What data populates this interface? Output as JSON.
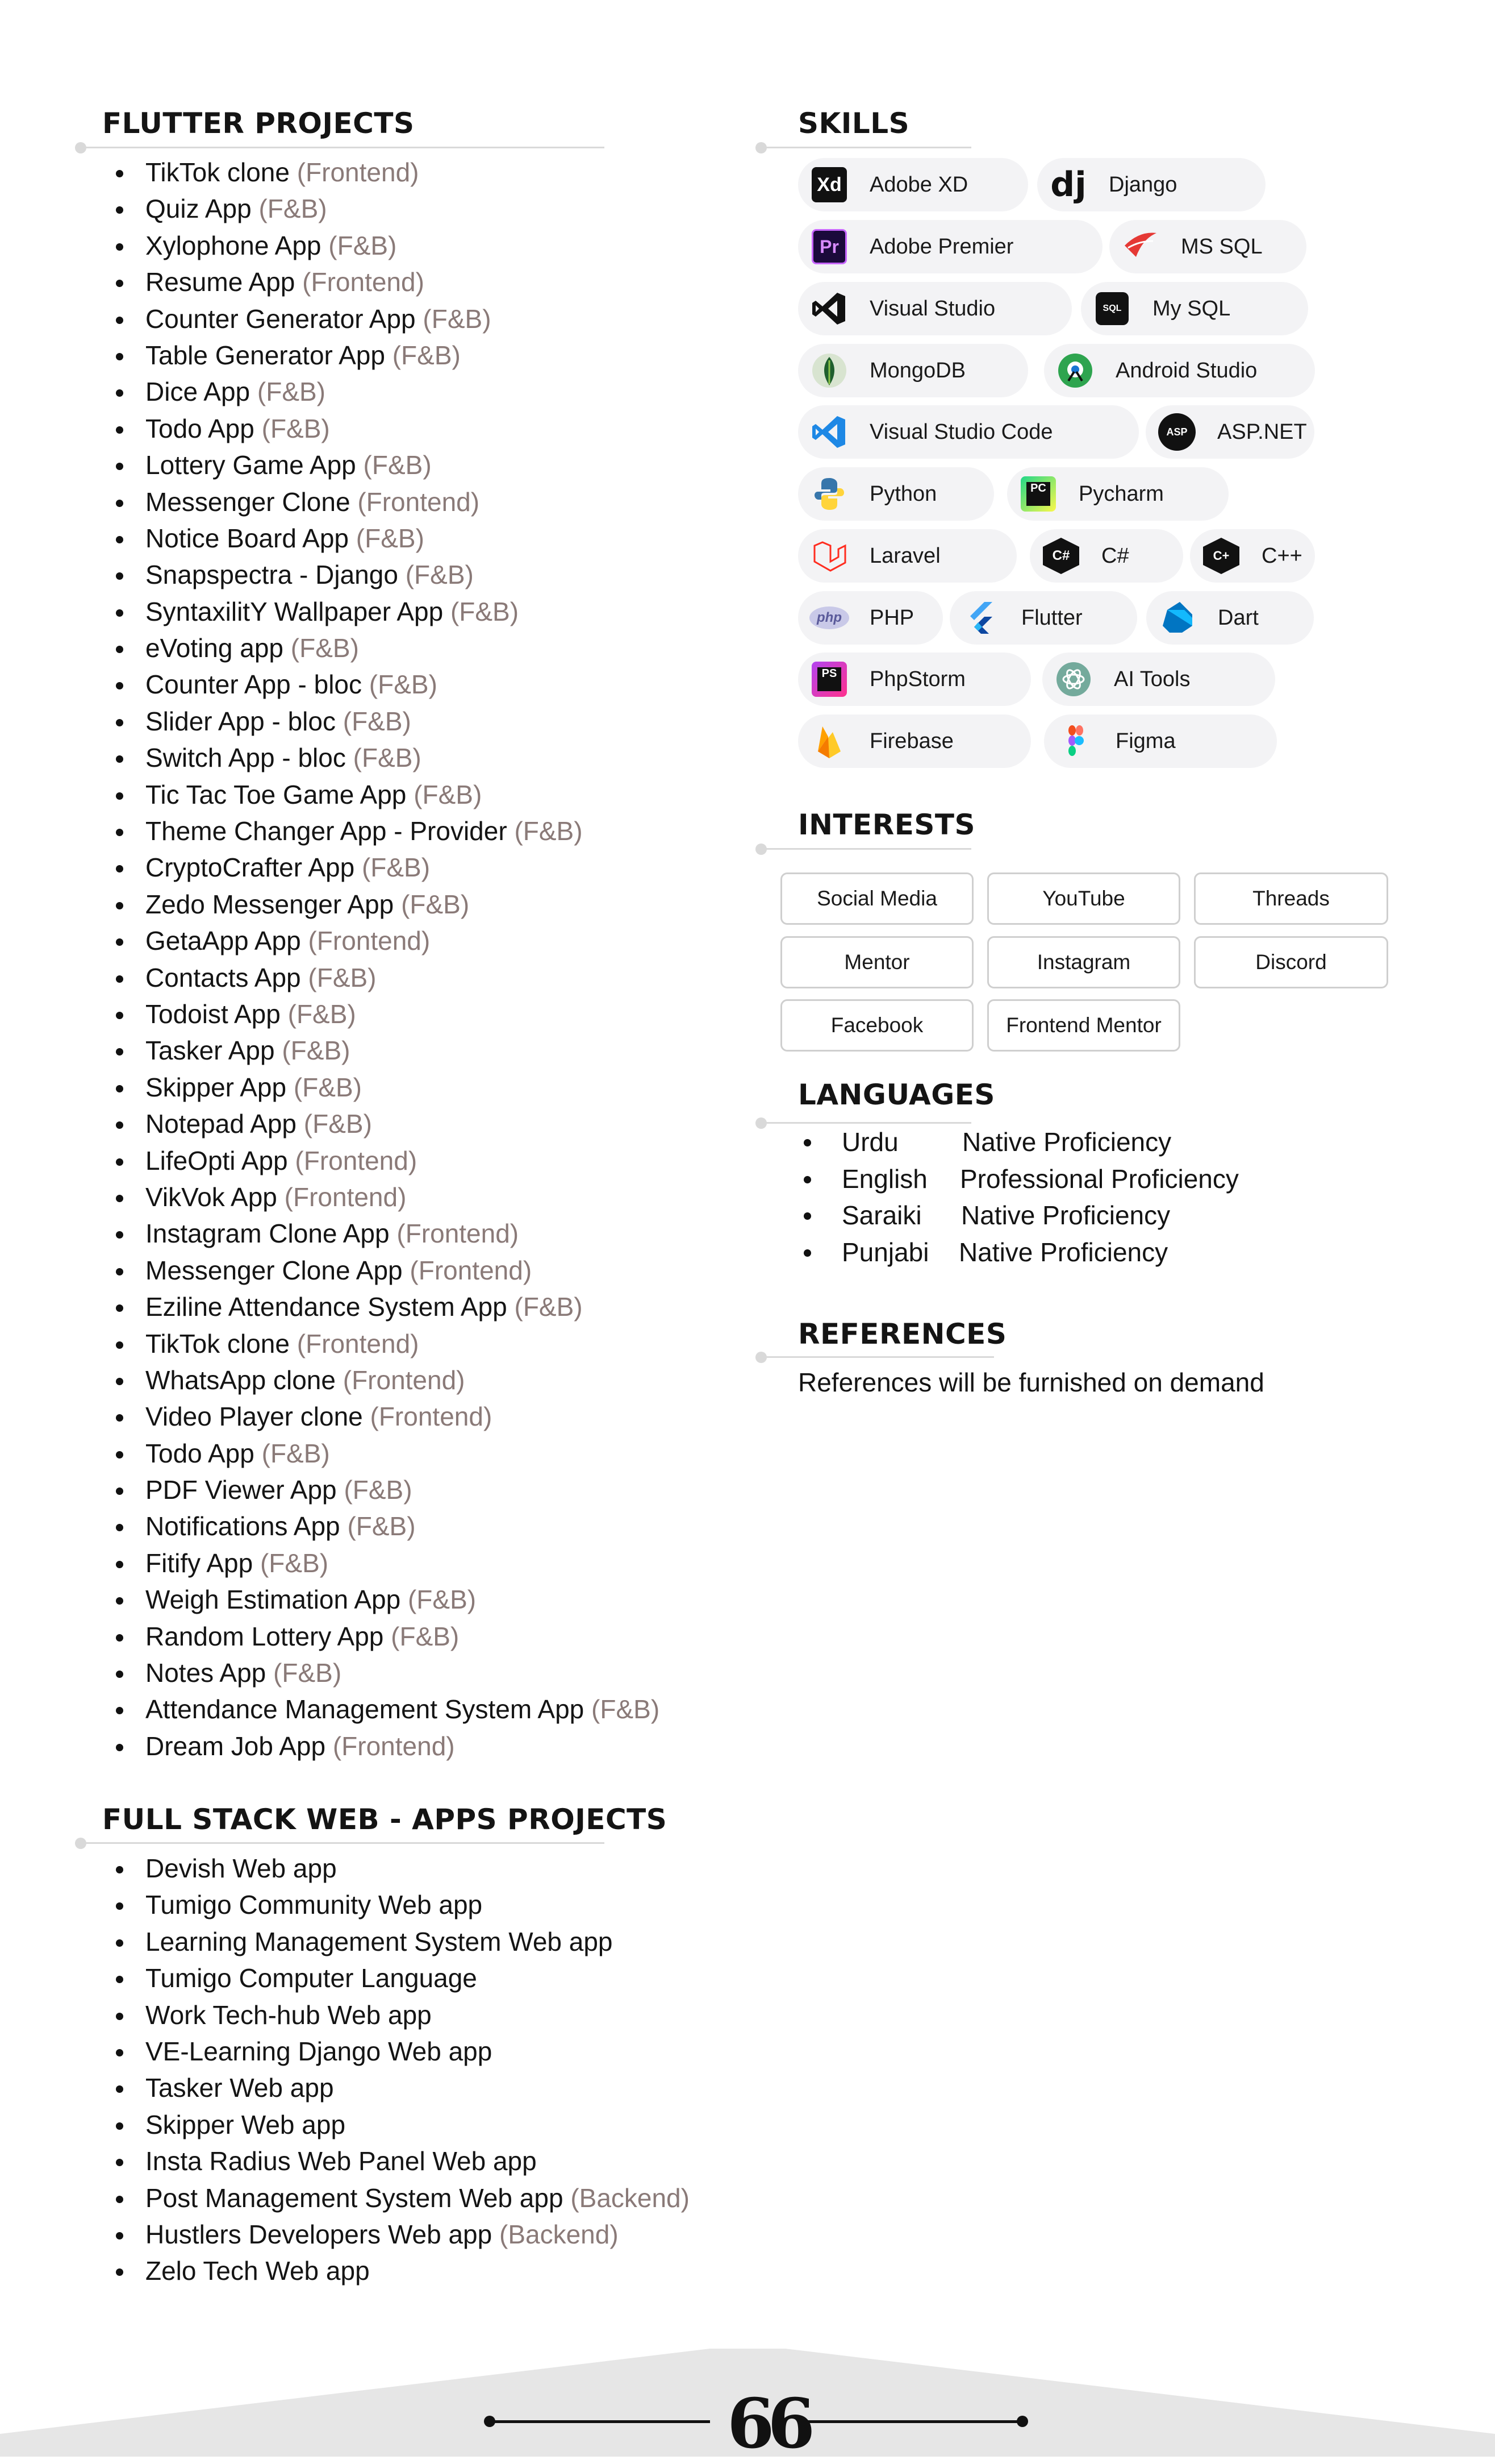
{
  "flutter": {
    "title": "FLUTTER PROJECTS",
    "items": [
      {
        "name": "TikTok clone",
        "tag": "(Frontend)"
      },
      {
        "name": "Quiz App",
        "tag": "(F&B)"
      },
      {
        "name": "Xylophone App",
        "tag": "(F&B)"
      },
      {
        "name": "Resume App",
        "tag": "(Frontend)"
      },
      {
        "name": "Counter Generator App",
        "tag": "(F&B)"
      },
      {
        "name": "Table Generator App",
        "tag": "(F&B)"
      },
      {
        "name": "Dice App",
        "tag": "(F&B)"
      },
      {
        "name": "Todo App",
        "tag": "(F&B)"
      },
      {
        "name": "Lottery Game App",
        "tag": "(F&B)"
      },
      {
        "name": "Messenger Clone",
        "tag": "(Frontend)"
      },
      {
        "name": "Notice Board App",
        "tag": "(F&B)"
      },
      {
        "name": "Snapspectra - Django",
        "tag": "(F&B)"
      },
      {
        "name": "SyntaxilitY Wallpaper App",
        "tag": "(F&B)"
      },
      {
        "name": "eVoting app",
        "tag": "(F&B)"
      },
      {
        "name": "Counter App - bloc",
        "tag": "(F&B)"
      },
      {
        "name": "Slider App - bloc",
        "tag": "(F&B)"
      },
      {
        "name": "Switch App - bloc",
        "tag": "(F&B)"
      },
      {
        "name": "Tic Tac Toe Game App",
        "tag": "(F&B)"
      },
      {
        "name": "Theme Changer App - Provider",
        "tag": "(F&B)"
      },
      {
        "name": "CryptoCrafter App",
        "tag": "(F&B)"
      },
      {
        "name": "Zedo Messenger App",
        "tag": "(F&B)"
      },
      {
        "name": "GetaApp App",
        "tag": "(Frontend)"
      },
      {
        "name": "Contacts App",
        "tag": "(F&B)"
      },
      {
        "name": "Todoist App",
        "tag": "(F&B)"
      },
      {
        "name": "Tasker App",
        "tag": "(F&B)"
      },
      {
        "name": "Skipper App",
        "tag": "(F&B)"
      },
      {
        "name": "Notepad App",
        "tag": "(F&B)"
      },
      {
        "name": "LifeOpti App",
        "tag": "(Frontend)"
      },
      {
        "name": "VikVok App",
        "tag": "(Frontend)"
      },
      {
        "name": "Instagram Clone App",
        "tag": "(Frontend)"
      },
      {
        "name": "Messenger Clone App",
        "tag": "(Frontend)"
      },
      {
        "name": "Eziline Attendance System App",
        "tag": "(F&B)"
      },
      {
        "name": "TikTok clone",
        "tag": "(Frontend)"
      },
      {
        "name": "WhatsApp clone",
        "tag": "(Frontend)"
      },
      {
        "name": "Video Player clone",
        "tag": "(Frontend)"
      },
      {
        "name": "Todo App",
        "tag": "(F&B)"
      },
      {
        "name": "PDF Viewer App",
        "tag": "(F&B)"
      },
      {
        "name": "Notifications App",
        "tag": "(F&B)"
      },
      {
        "name": "Fitify App",
        "tag": "(F&B)"
      },
      {
        "name": "Weigh Estimation App",
        "tag": "(F&B)"
      },
      {
        "name": "Random Lottery App",
        "tag": "(F&B)"
      },
      {
        "name": "Notes App",
        "tag": "(F&B)"
      },
      {
        "name": "Attendance Management System App",
        "tag": "(F&B)"
      },
      {
        "name": "Dream Job App",
        "tag": "(Frontend)"
      }
    ]
  },
  "fullstack": {
    "title": "FULL STACK WEB - APPS PROJECTS",
    "items": [
      {
        "name": "Devish Web app",
        "tag": ""
      },
      {
        "name": "Tumigo Community Web app",
        "tag": ""
      },
      {
        "name": "Learning Management System Web app",
        "tag": ""
      },
      {
        "name": "Tumigo Computer Language",
        "tag": ""
      },
      {
        "name": "Work Tech-hub Web app",
        "tag": ""
      },
      {
        "name": "VE-Learning Django Web app",
        "tag": ""
      },
      {
        "name": "Tasker Web app",
        "tag": ""
      },
      {
        "name": "Skipper Web app",
        "tag": ""
      },
      {
        "name": "Insta Radius Web Panel Web app",
        "tag": ""
      },
      {
        "name": "Post Management System Web app",
        "tag": "(Backend)"
      },
      {
        "name": "Hustlers Developers Web app",
        "tag": "(Backend)"
      },
      {
        "name": "Zelo Tech Web app",
        "tag": ""
      }
    ]
  },
  "skills": {
    "title": "SKILLS",
    "items": [
      {
        "label": "Adobe XD",
        "icon": "adobe-xd-icon",
        "glyph": "Xd",
        "color": "#111111"
      },
      {
        "label": "Django",
        "icon": "django-icon",
        "glyph": "dj",
        "color": "#ffffff"
      },
      {
        "label": "Adobe Premier",
        "icon": "adobe-premiere-icon",
        "glyph": "Pr",
        "color": "#111111"
      },
      {
        "label": "MS SQL",
        "icon": "ms-sql-icon",
        "glyph": "",
        "color": "#ffffff"
      },
      {
        "label": "Visual Studio",
        "icon": "visual-studio-icon",
        "glyph": "",
        "color": "#ffffff"
      },
      {
        "label": "My SQL",
        "icon": "mysql-icon",
        "glyph": "SQL",
        "color": "#111111"
      },
      {
        "label": "MongoDB",
        "icon": "mongodb-icon",
        "glyph": "",
        "color": "#ffffff"
      },
      {
        "label": "Android Studio",
        "icon": "android-studio-icon",
        "glyph": "",
        "color": "#ffffff"
      },
      {
        "label": "Visual Studio Code",
        "icon": "vscode-icon",
        "glyph": "",
        "color": "#ffffff"
      },
      {
        "label": "ASP.NET",
        "icon": "aspnet-icon",
        "glyph": "ASP",
        "color": "#111111"
      },
      {
        "label": "Python",
        "icon": "python-icon",
        "glyph": "",
        "color": "#ffffff"
      },
      {
        "label": "Pycharm",
        "icon": "pycharm-icon",
        "glyph": "PC",
        "color": "#111111"
      },
      {
        "label": "Laravel",
        "icon": "laravel-icon",
        "glyph": "",
        "color": "#ffffff"
      },
      {
        "label": "C#",
        "icon": "csharp-icon",
        "glyph": "C#",
        "color": "#111111"
      },
      {
        "label": "C++",
        "icon": "cpp-icon",
        "glyph": "C+",
        "color": "#111111"
      },
      {
        "label": "PHP",
        "icon": "php-icon",
        "glyph": "php",
        "color": "#ffffff"
      },
      {
        "label": "Flutter",
        "icon": "flutter-icon",
        "glyph": "",
        "color": "#ffffff"
      },
      {
        "label": "Dart",
        "icon": "dart-icon",
        "glyph": "",
        "color": "#ffffff"
      },
      {
        "label": "PhpStorm",
        "icon": "phpstorm-icon",
        "glyph": "PS",
        "color": "#111111"
      },
      {
        "label": "AI Tools",
        "icon": "ai-tools-icon",
        "glyph": "",
        "color": "#ffffff"
      },
      {
        "label": "Firebase",
        "icon": "firebase-icon",
        "glyph": "",
        "color": "#ffffff"
      },
      {
        "label": "Figma",
        "icon": "figma-icon",
        "glyph": "",
        "color": "#ffffff"
      }
    ]
  },
  "interests": {
    "title": "INTERESTS",
    "items": [
      "Social Media",
      "YouTube",
      "Threads",
      "Mentor",
      "Instagram",
      "Discord",
      "Facebook",
      "Frontend Mentor"
    ]
  },
  "languages": {
    "title": "LANGUAGES",
    "items": [
      {
        "name": "Urdu",
        "level": "Native Proficiency"
      },
      {
        "name": "English",
        "level": "Professional Proficiency"
      },
      {
        "name": "Saraiki",
        "level": "Native Proficiency"
      },
      {
        "name": "Punjabi",
        "level": "Native Proficiency"
      }
    ]
  },
  "references": {
    "title": "REFERENCES",
    "text": "References will be furnished on demand"
  },
  "footer": {
    "quote_glyph": "66"
  }
}
